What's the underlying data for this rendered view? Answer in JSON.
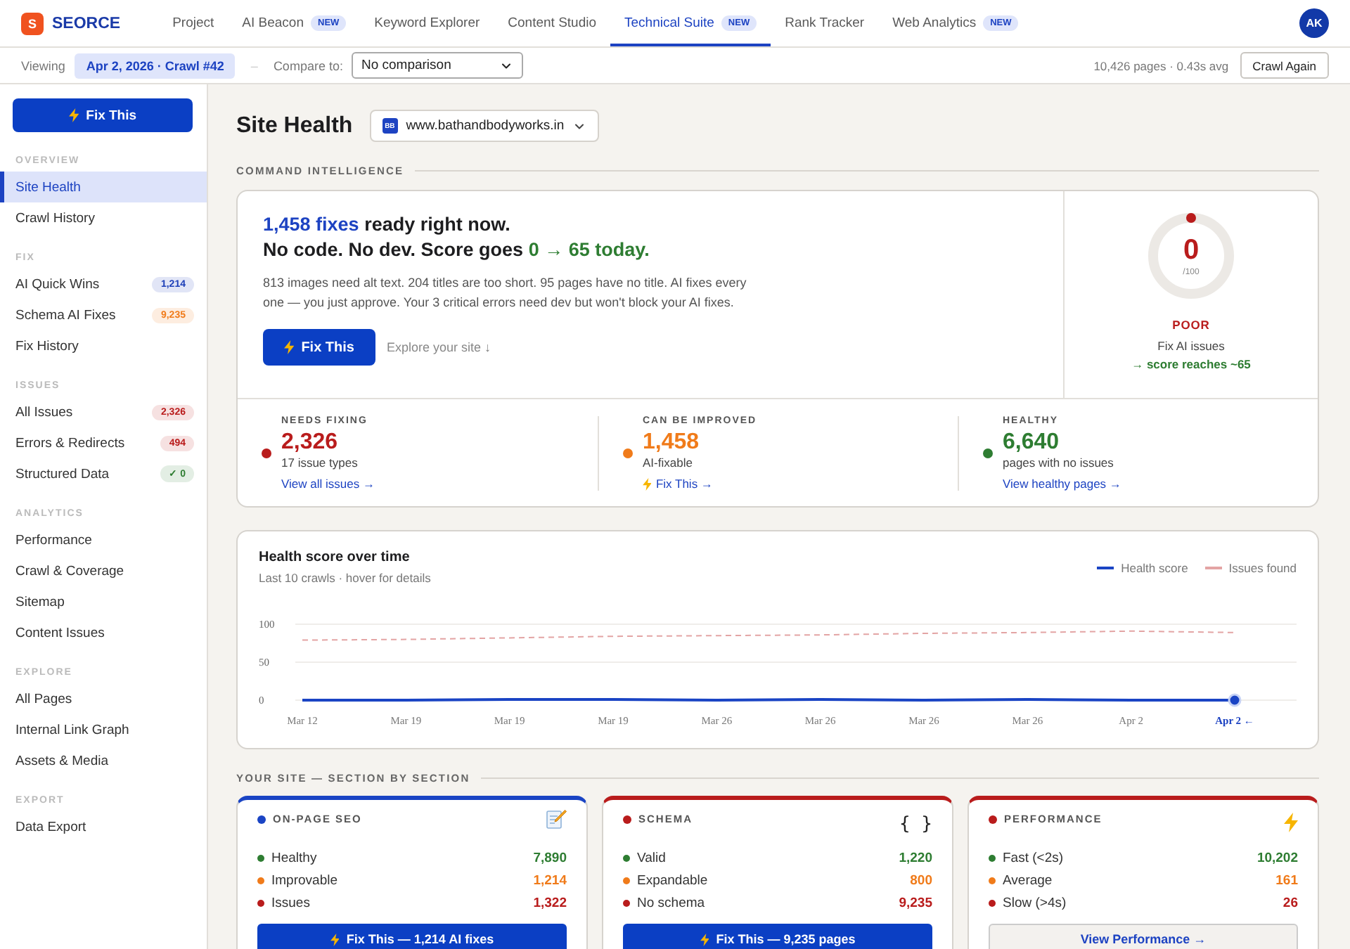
{
  "brand": {
    "logo_letter": "S",
    "name": "SEORCE"
  },
  "nav": [
    {
      "label": "Project",
      "selected": false
    },
    {
      "label": "AI Beacon",
      "badge": "NEW",
      "selected": false
    },
    {
      "label": "Keyword Explorer",
      "selected": false
    },
    {
      "label": "Content Studio",
      "selected": false
    },
    {
      "label": "Technical Suite",
      "badge": "NEW",
      "selected": true
    },
    {
      "label": "Rank Tracker",
      "selected": false
    },
    {
      "label": "Web Analytics",
      "badge": "NEW",
      "selected": false
    }
  ],
  "avatar": {
    "initials": "AK"
  },
  "crawl_bar": {
    "viewing_label": "Viewing",
    "crawl": "Apr 2, 2026 · Crawl #42",
    "separator": "–",
    "compare_label": "Compare to:",
    "compare_value": "No comparison",
    "stats": "10,426 pages · 0.43s avg",
    "action": "Crawl Again"
  },
  "sidebar": {
    "action": "Fix This",
    "sections": [
      {
        "title": "OVERVIEW",
        "items": [
          {
            "label": "Site Health",
            "selected": true
          },
          {
            "label": "Crawl History",
            "selected": false
          }
        ]
      },
      {
        "title": "FIX",
        "items": [
          {
            "label": "AI Quick Wins",
            "selected": false,
            "badge": {
              "text": "1,214",
              "color": "#1d3fb8"
            }
          },
          {
            "label": "Schema AI Fixes",
            "selected": false,
            "badge": {
              "text": "9,235",
              "color": "#f07b1a"
            }
          },
          {
            "label": "Fix History",
            "selected": false
          }
        ]
      },
      {
        "title": "ISSUES",
        "items": [
          {
            "label": "All Issues",
            "selected": false,
            "badge": {
              "text": "2,326",
              "color": "#b91c1c"
            }
          },
          {
            "label": "Errors & Redirects",
            "selected": false,
            "badge": {
              "text": "494",
              "color": "#b91c1c"
            }
          },
          {
            "label": "Structured Data",
            "selected": false,
            "badge": {
              "text": "✓ 0",
              "color": "#2e7d32"
            }
          }
        ]
      },
      {
        "title": "ANALYTICS",
        "items": [
          {
            "label": "Performance",
            "selected": false
          },
          {
            "label": "Crawl & Coverage",
            "selected": false
          },
          {
            "label": "Sitemap",
            "selected": false
          },
          {
            "label": "Content Issues",
            "selected": false
          }
        ]
      },
      {
        "title": "EXPLORE",
        "items": [
          {
            "label": "All Pages",
            "selected": false
          },
          {
            "label": "Internal Link Graph",
            "selected": false
          },
          {
            "label": "Assets & Media",
            "selected": false
          }
        ]
      },
      {
        "title": "EXPORT",
        "items": [
          {
            "label": "Data Export",
            "selected": false
          }
        ]
      }
    ]
  },
  "page": {
    "title": "Site Health",
    "site": {
      "favicon": "BB",
      "domain": "www.bathandbodyworks.in"
    }
  },
  "command_intelligence": {
    "section_title": "COMMAND INTELLIGENCE",
    "headline": {
      "fix_count": "1,458 fixes",
      "first_line": "ready right now.",
      "second_line": "No code. No dev. Score goes",
      "outcome": "0 → 65 today."
    },
    "summary": "813 images need alt text. 204 titles are too short. 95 pages have no title. AI fixes every one — you just approve. Your 3 critical errors need dev but won't block your AI fixes.",
    "primary_action": "Fix This",
    "secondary_action": "Explore your site ↓",
    "score": {
      "value": "0",
      "max": "/100",
      "level": 0,
      "rating": "POOR",
      "note": "Fix AI issues",
      "projection": "→ score reaches ~65"
    },
    "stats": [
      {
        "label": "NEEDS FIXING",
        "value": "2,326",
        "color": "#b91c1c",
        "detail": "17 issue types",
        "link": {
          "kind": "view",
          "label": "View all issues →"
        }
      },
      {
        "label": "CAN BE IMPROVED",
        "value": "1,458",
        "color": "#f07b1a",
        "detail": "AI-fixable",
        "link": {
          "kind": "fix",
          "label": "Fix This →"
        }
      },
      {
        "label": "HEALTHY",
        "value": "6,640",
        "color": "#2e7d32",
        "detail": "pages with no issues",
        "link": {
          "kind": "view",
          "label": "View healthy pages →"
        }
      }
    ]
  },
  "health_chart": {
    "title": "Health score over time",
    "subtitle": "Last 10 crawls · hover for details",
    "chart_data": {
      "type": "line",
      "categories": [
        "Mar 12",
        "Mar 19",
        "Mar 19",
        "Mar 19",
        "Mar 26",
        "Mar 26",
        "Mar 26",
        "Mar 26",
        "Apr 2",
        "Apr 2 ←"
      ],
      "series": [
        {
          "name": "Health score",
          "color": "#1a44c4",
          "line_style": "solid",
          "values": [
            0,
            0,
            1,
            1,
            0,
            1,
            0,
            1,
            0,
            0
          ]
        },
        {
          "name": "Issues found",
          "color": "#e3a4a4",
          "line_style": "dashed",
          "values": [
            79,
            80,
            82,
            84,
            85,
            86,
            88,
            89,
            91,
            89
          ]
        }
      ],
      "ylim": [
        0,
        100
      ],
      "yticks": [
        0,
        50,
        100
      ]
    }
  },
  "site_sections": {
    "title": "YOUR SITE — SECTION BY SECTION",
    "cards": [
      {
        "title": "ON-PAGE SEO",
        "color": "#1a44c4",
        "icon": {
          "kind": "memo"
        },
        "rows": [
          {
            "label": "Healthy",
            "value": "7,890",
            "color": "#2e7d32"
          },
          {
            "label": "Improvable",
            "value": "1,214",
            "color": "#f07b1a"
          },
          {
            "label": "Issues",
            "value": "1,322",
            "color": "#b91c1c"
          }
        ],
        "button": {
          "kind": "fix",
          "label": "Fix This — 1,214 AI fixes"
        }
      },
      {
        "title": "SCHEMA",
        "color": "#b91c1c",
        "icon": {
          "kind": "text",
          "text": "{ }"
        },
        "rows": [
          {
            "label": "Valid",
            "value": "1,220",
            "color": "#2e7d32"
          },
          {
            "label": "Expandable",
            "value": "800",
            "color": "#f07b1a"
          },
          {
            "label": "No schema",
            "value": "9,235",
            "color": "#b91c1c"
          }
        ],
        "button": {
          "kind": "fix",
          "label": "Fix This — 9,235 pages"
        }
      },
      {
        "title": "PERFORMANCE",
        "color": "#b91c1c",
        "icon": {
          "kind": "bolt"
        },
        "rows": [
          {
            "label": "Fast (<2s)",
            "value": "10,202",
            "color": "#2e7d32"
          },
          {
            "label": "Average",
            "value": "161",
            "color": "#f07b1a"
          },
          {
            "label": "Slow (>4s)",
            "value": "26",
            "color": "#b91c1c"
          }
        ],
        "button": {
          "kind": "view",
          "label": "View Performance →"
        }
      }
    ]
  }
}
